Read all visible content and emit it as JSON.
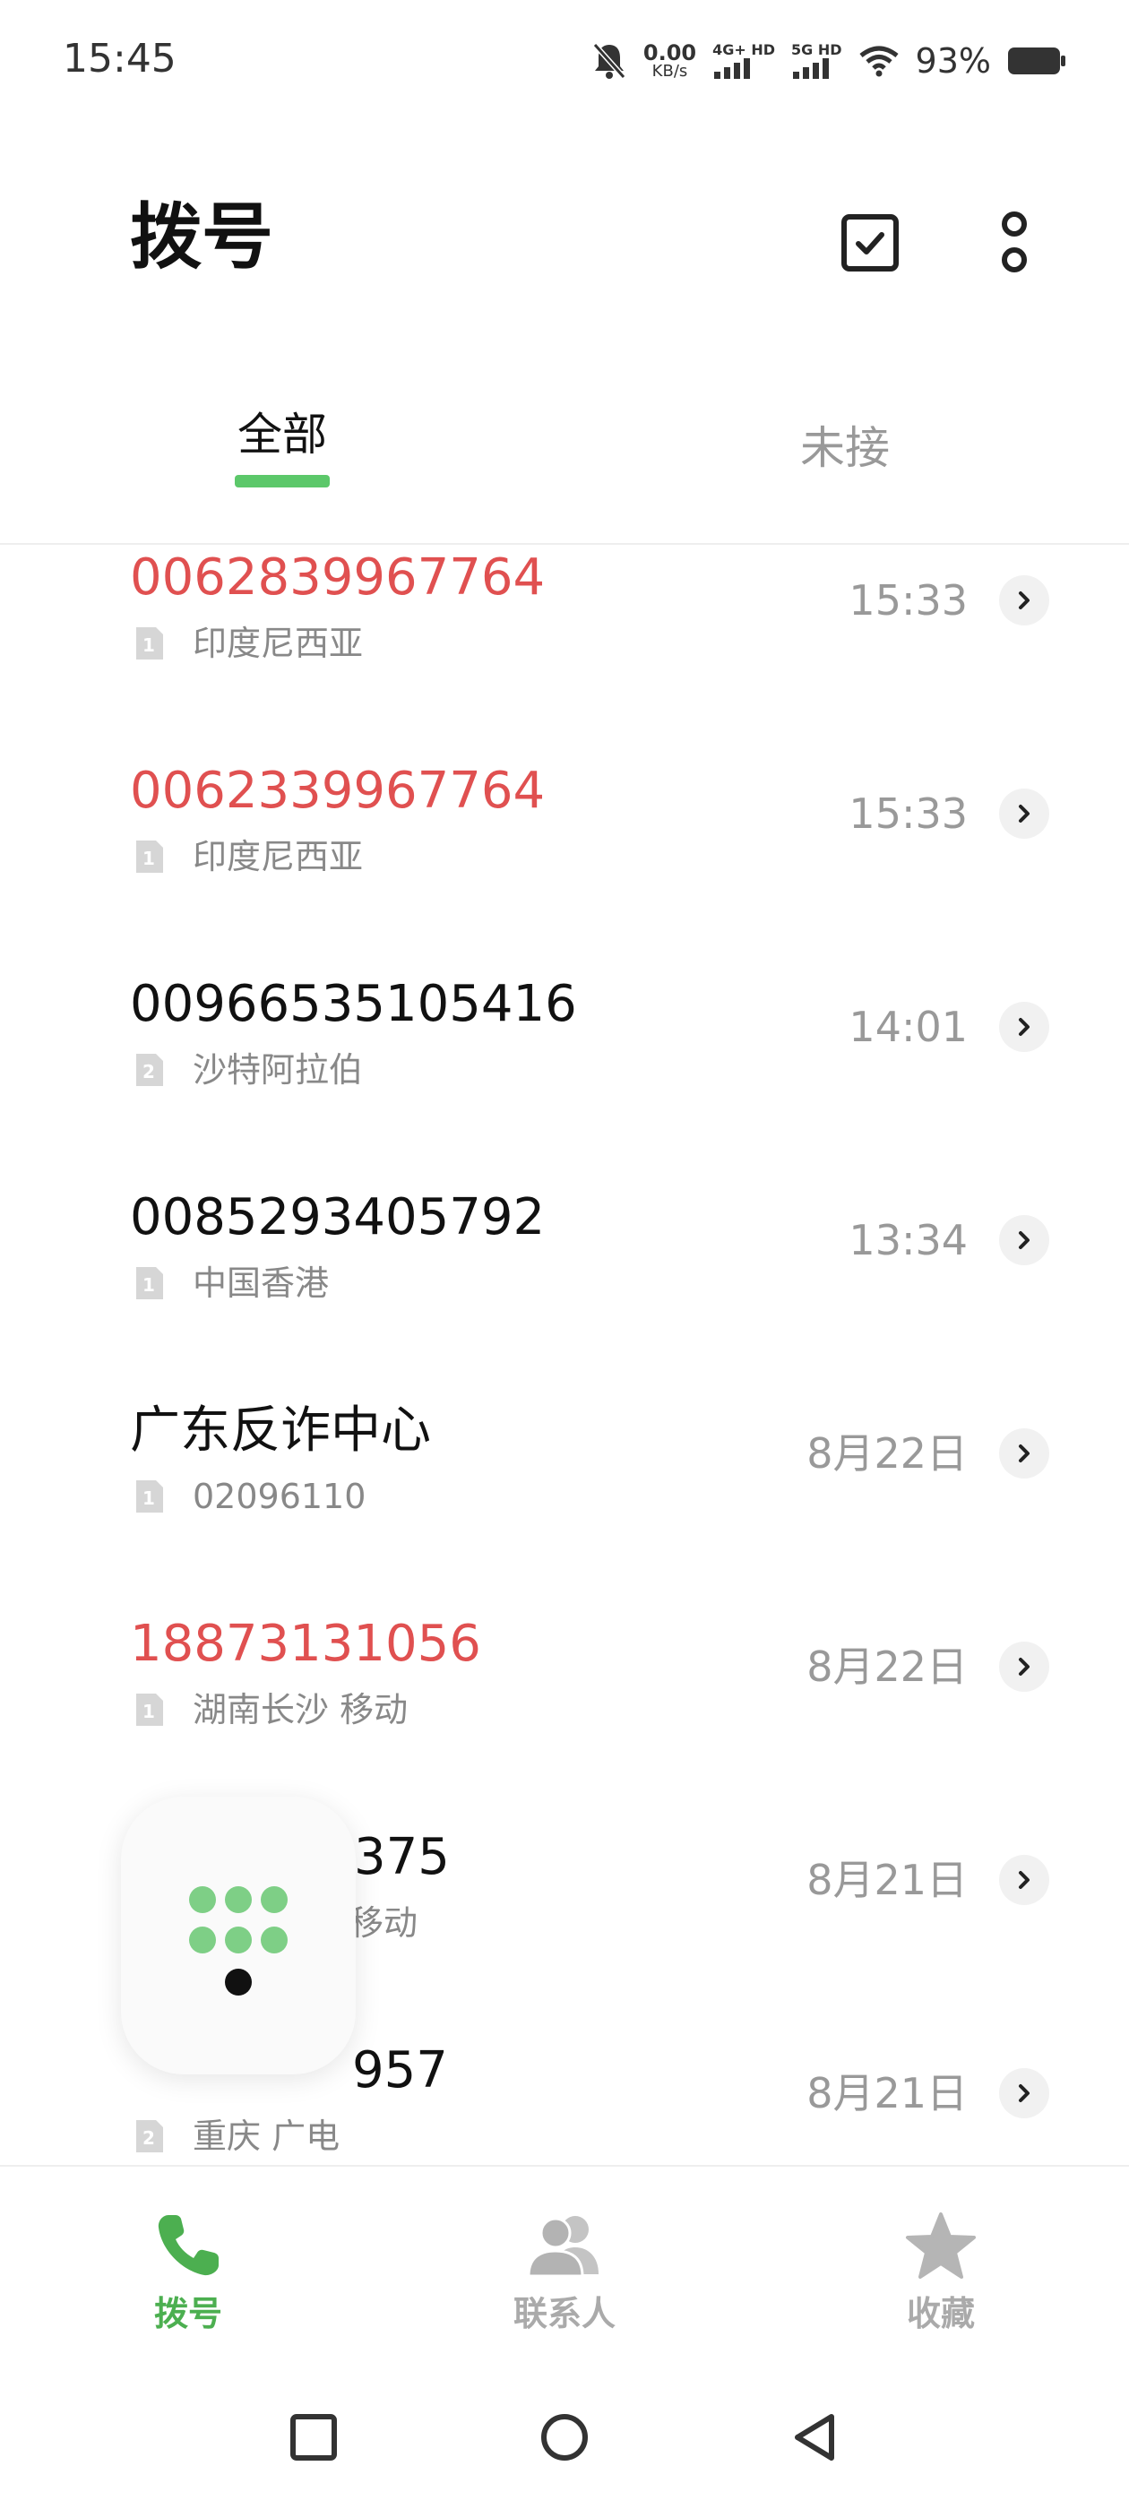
{
  "status_bar": {
    "time": "15:45",
    "net_speed_value": "0.00",
    "net_speed_unit": "KB/s",
    "sim1_label": "4G+ HD",
    "sim2_label": "5G HD",
    "battery_percent": "93%"
  },
  "header": {
    "title": "拨号",
    "select_icon": "checkbox-icon",
    "more_icon": "more-vertical-icon"
  },
  "tabs": [
    {
      "label": "全部",
      "active": true
    },
    {
      "label": "未接",
      "active": false
    }
  ],
  "calls": [
    {
      "name": "0062839967764",
      "missed": true,
      "sim": "1",
      "sub": "印度尼西亚",
      "time": "15:33"
    },
    {
      "name": "0062339967764",
      "missed": true,
      "sim": "1",
      "sub": "印度尼西亚",
      "time": "15:33"
    },
    {
      "name": "00966535105416",
      "missed": false,
      "sim": "2",
      "sub": "沙特阿拉伯",
      "time": "14:01"
    },
    {
      "name": "0085293405792",
      "missed": false,
      "sim": "1",
      "sub": "中国香港",
      "time": "13:34"
    },
    {
      "name": "广东反诈中心",
      "missed": false,
      "sim": "1",
      "sub": "02096110",
      "time": "8月22日"
    },
    {
      "name": "18873131056",
      "missed": true,
      "sim": "1",
      "sub": "湖南长沙  移动",
      "time": "8月22日"
    },
    {
      "name": "375",
      "missed": false,
      "sim": "1",
      "sub": "移动",
      "time": "8月21日"
    },
    {
      "name": "957",
      "missed": false,
      "sim": "2",
      "sub": "重庆  广电",
      "time": "8月21日"
    }
  ],
  "bottom_nav": [
    {
      "label": "拨号",
      "icon": "phone-icon",
      "active": true
    },
    {
      "label": "联系人",
      "icon": "contacts-icon",
      "active": false
    },
    {
      "label": "收藏",
      "icon": "star-icon",
      "active": false
    }
  ],
  "colors": {
    "accent": "#4caf50",
    "missed": "#e05050",
    "muted": "#999999"
  }
}
